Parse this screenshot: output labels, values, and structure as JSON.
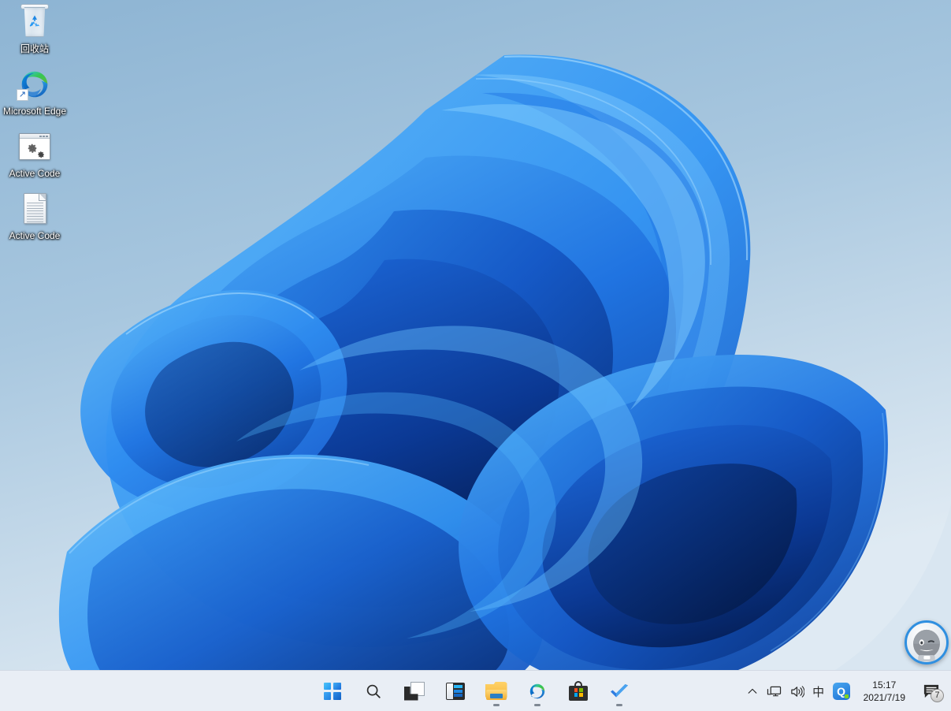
{
  "desktop": {
    "icons": [
      {
        "name": "recycle-bin",
        "label": "回收站",
        "icon": "recycle-bin-icon"
      },
      {
        "name": "microsoft-edge",
        "label": "Microsoft Edge",
        "icon": "edge-icon"
      },
      {
        "name": "active-code-app",
        "label": "Active Code",
        "icon": "application-window-gears-icon"
      },
      {
        "name": "active-code-doc",
        "label": "Active Code",
        "icon": "text-document-icon"
      }
    ]
  },
  "assistant": {
    "name": "assistant-avatar",
    "icon": "robot-face-icon",
    "ring_color": "#2f8fe0"
  },
  "taskbar": {
    "background_color": "#e9eef5",
    "buttons": [
      {
        "name": "start",
        "label": "Start",
        "icon": "windows-logo-icon",
        "running": false
      },
      {
        "name": "search",
        "label": "Search",
        "icon": "search-icon",
        "running": false
      },
      {
        "name": "task-view",
        "label": "Task View",
        "icon": "task-view-icon",
        "running": false
      },
      {
        "name": "widgets",
        "label": "Widgets",
        "icon": "widgets-icon",
        "running": false
      },
      {
        "name": "file-explorer",
        "label": "File Explorer",
        "icon": "folder-icon",
        "running": true
      },
      {
        "name": "edge",
        "label": "Microsoft Edge",
        "icon": "edge-icon",
        "running": true
      },
      {
        "name": "microsoft-store",
        "label": "Microsoft Store",
        "icon": "store-bag-icon",
        "running": false
      },
      {
        "name": "todo",
        "label": "To Do",
        "icon": "blue-checkmark-icon",
        "running": true
      }
    ],
    "tray": {
      "overflow": {
        "name": "show-hidden-icons",
        "icon": "chevron-up-icon"
      },
      "network": {
        "name": "network",
        "icon": "network-monitor-icon"
      },
      "volume": {
        "name": "volume",
        "icon": "speaker-icon"
      },
      "ime": {
        "name": "input-method",
        "label": "中",
        "icon": "ime-chinese-icon"
      },
      "qq": {
        "name": "qq",
        "label": "Q",
        "icon": "qq-icon"
      },
      "clock": {
        "time": "15:17",
        "date": "2021/7/19"
      },
      "notifications": {
        "name": "notification-center",
        "icon": "chat-bubble-icon",
        "count": "7"
      }
    }
  }
}
